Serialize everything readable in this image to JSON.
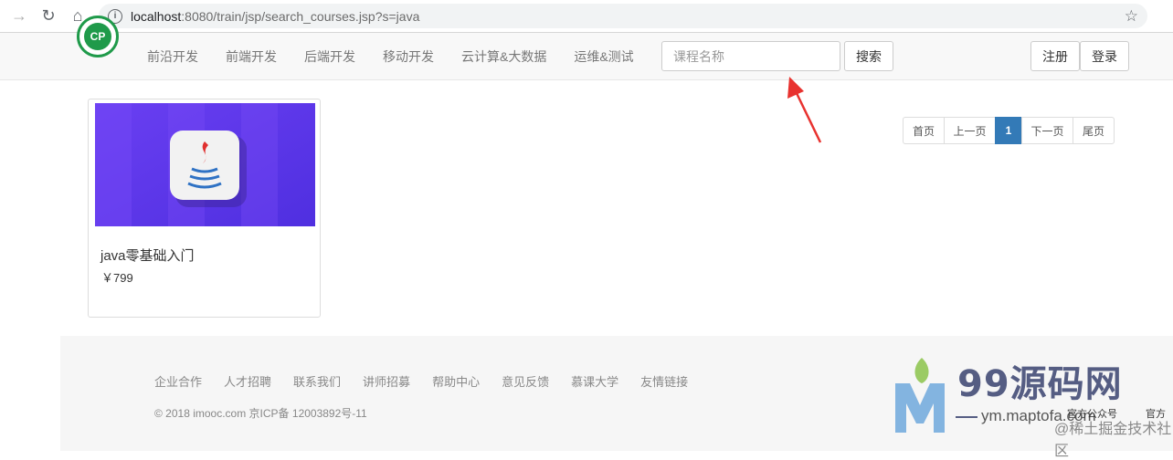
{
  "browser": {
    "url_host": "localhost",
    "url_path": ":8080/train/jsp/search_courses.jsp?s=java"
  },
  "navbar": {
    "logo_text": "CP",
    "links": [
      "前沿开发",
      "前端开发",
      "后端开发",
      "移动开发",
      "云计算&大数据",
      "运维&测试"
    ],
    "search_placeholder": "课程名称",
    "search_button": "搜索",
    "register_button": "注册",
    "login_button": "登录"
  },
  "course": {
    "title": "java零基础入门",
    "price": "￥799"
  },
  "pagination": {
    "first": "首页",
    "prev": "上一页",
    "current": "1",
    "next": "下一页",
    "last": "尾页"
  },
  "footer": {
    "links": [
      "企业合作",
      "人才招聘",
      "联系我们",
      "讲师招募",
      "帮助中心",
      "意见反馈",
      "慕课大学",
      "友情链接"
    ],
    "copyright": "© 2018 imooc.com  京ICP备 12003892号-11"
  },
  "watermark": {
    "brand": "99源码网",
    "url": "ym.maptofa.com",
    "official1": "官方公众号",
    "official2": "官方",
    "juejin": "@稀土掘金技术社区"
  },
  "colors": {
    "active_page": "#337ab7",
    "arrow": "#e8322f",
    "thumb_bg": "#5b3df0"
  }
}
